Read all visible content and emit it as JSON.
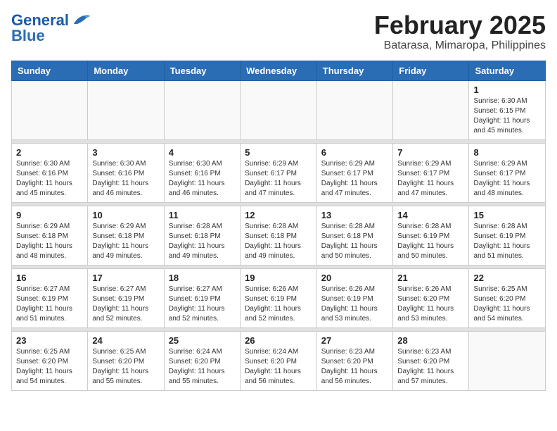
{
  "header": {
    "logo_line1": "General",
    "logo_line2": "Blue",
    "title": "February 2025",
    "subtitle": "Batarasa, Mimaropa, Philippines"
  },
  "weekdays": [
    "Sunday",
    "Monday",
    "Tuesday",
    "Wednesday",
    "Thursday",
    "Friday",
    "Saturday"
  ],
  "weeks": [
    [
      {
        "day": "",
        "info": ""
      },
      {
        "day": "",
        "info": ""
      },
      {
        "day": "",
        "info": ""
      },
      {
        "day": "",
        "info": ""
      },
      {
        "day": "",
        "info": ""
      },
      {
        "day": "",
        "info": ""
      },
      {
        "day": "1",
        "info": "Sunrise: 6:30 AM\nSunset: 6:15 PM\nDaylight: 11 hours\nand 45 minutes."
      }
    ],
    [
      {
        "day": "2",
        "info": "Sunrise: 6:30 AM\nSunset: 6:16 PM\nDaylight: 11 hours\nand 45 minutes."
      },
      {
        "day": "3",
        "info": "Sunrise: 6:30 AM\nSunset: 6:16 PM\nDaylight: 11 hours\nand 46 minutes."
      },
      {
        "day": "4",
        "info": "Sunrise: 6:30 AM\nSunset: 6:16 PM\nDaylight: 11 hours\nand 46 minutes."
      },
      {
        "day": "5",
        "info": "Sunrise: 6:29 AM\nSunset: 6:17 PM\nDaylight: 11 hours\nand 47 minutes."
      },
      {
        "day": "6",
        "info": "Sunrise: 6:29 AM\nSunset: 6:17 PM\nDaylight: 11 hours\nand 47 minutes."
      },
      {
        "day": "7",
        "info": "Sunrise: 6:29 AM\nSunset: 6:17 PM\nDaylight: 11 hours\nand 47 minutes."
      },
      {
        "day": "8",
        "info": "Sunrise: 6:29 AM\nSunset: 6:17 PM\nDaylight: 11 hours\nand 48 minutes."
      }
    ],
    [
      {
        "day": "9",
        "info": "Sunrise: 6:29 AM\nSunset: 6:18 PM\nDaylight: 11 hours\nand 48 minutes."
      },
      {
        "day": "10",
        "info": "Sunrise: 6:29 AM\nSunset: 6:18 PM\nDaylight: 11 hours\nand 49 minutes."
      },
      {
        "day": "11",
        "info": "Sunrise: 6:28 AM\nSunset: 6:18 PM\nDaylight: 11 hours\nand 49 minutes."
      },
      {
        "day": "12",
        "info": "Sunrise: 6:28 AM\nSunset: 6:18 PM\nDaylight: 11 hours\nand 49 minutes."
      },
      {
        "day": "13",
        "info": "Sunrise: 6:28 AM\nSunset: 6:18 PM\nDaylight: 11 hours\nand 50 minutes."
      },
      {
        "day": "14",
        "info": "Sunrise: 6:28 AM\nSunset: 6:19 PM\nDaylight: 11 hours\nand 50 minutes."
      },
      {
        "day": "15",
        "info": "Sunrise: 6:28 AM\nSunset: 6:19 PM\nDaylight: 11 hours\nand 51 minutes."
      }
    ],
    [
      {
        "day": "16",
        "info": "Sunrise: 6:27 AM\nSunset: 6:19 PM\nDaylight: 11 hours\nand 51 minutes."
      },
      {
        "day": "17",
        "info": "Sunrise: 6:27 AM\nSunset: 6:19 PM\nDaylight: 11 hours\nand 52 minutes."
      },
      {
        "day": "18",
        "info": "Sunrise: 6:27 AM\nSunset: 6:19 PM\nDaylight: 11 hours\nand 52 minutes."
      },
      {
        "day": "19",
        "info": "Sunrise: 6:26 AM\nSunset: 6:19 PM\nDaylight: 11 hours\nand 52 minutes."
      },
      {
        "day": "20",
        "info": "Sunrise: 6:26 AM\nSunset: 6:19 PM\nDaylight: 11 hours\nand 53 minutes."
      },
      {
        "day": "21",
        "info": "Sunrise: 6:26 AM\nSunset: 6:20 PM\nDaylight: 11 hours\nand 53 minutes."
      },
      {
        "day": "22",
        "info": "Sunrise: 6:25 AM\nSunset: 6:20 PM\nDaylight: 11 hours\nand 54 minutes."
      }
    ],
    [
      {
        "day": "23",
        "info": "Sunrise: 6:25 AM\nSunset: 6:20 PM\nDaylight: 11 hours\nand 54 minutes."
      },
      {
        "day": "24",
        "info": "Sunrise: 6:25 AM\nSunset: 6:20 PM\nDaylight: 11 hours\nand 55 minutes."
      },
      {
        "day": "25",
        "info": "Sunrise: 6:24 AM\nSunset: 6:20 PM\nDaylight: 11 hours\nand 55 minutes."
      },
      {
        "day": "26",
        "info": "Sunrise: 6:24 AM\nSunset: 6:20 PM\nDaylight: 11 hours\nand 56 minutes."
      },
      {
        "day": "27",
        "info": "Sunrise: 6:23 AM\nSunset: 6:20 PM\nDaylight: 11 hours\nand 56 minutes."
      },
      {
        "day": "28",
        "info": "Sunrise: 6:23 AM\nSunset: 6:20 PM\nDaylight: 11 hours\nand 57 minutes."
      },
      {
        "day": "",
        "info": ""
      }
    ]
  ]
}
